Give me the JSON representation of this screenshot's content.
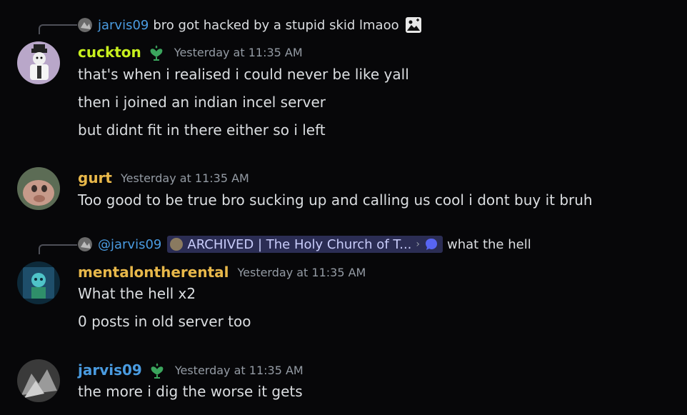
{
  "messages": [
    {
      "reply": {
        "author": "jarvis09",
        "text": "bro got hacked by a stupid skid lmaoo"
      },
      "author": "cuckton",
      "author_color": "#c8f01e",
      "timestamp": "Yesterday at 11:35 AM",
      "lines": [
        "that's when i realised i could never be like yall",
        "then i joined an indian incel server",
        "but didnt fit in there either so i left"
      ]
    },
    {
      "author": "gurt",
      "author_color": "#e8b84a",
      "timestamp": "Yesterday at 11:35 AM",
      "lines": [
        "Too good to be true bro sucking up and calling us cool i dont buy it bruh"
      ]
    },
    {
      "reply": {
        "author": "@jarvis09",
        "channel": "ARCHIVED | The Holy Church of T...",
        "text": "what the hell"
      },
      "author": "mentalontherental",
      "author_color": "#e8b84a",
      "timestamp": "Yesterday at 11:35 AM",
      "lines": [
        "What the hell x2",
        "0 posts in old server too"
      ]
    },
    {
      "author": "jarvis09",
      "author_color": "#4a9be0",
      "timestamp": "Yesterday at 11:35 AM",
      "lines": [
        "the more i dig the worse it gets"
      ]
    }
  ],
  "icons": {
    "badge": "heart-plant-icon",
    "image_attachment": "image-icon",
    "thread": "chat-bubble-icon",
    "chevron": "chevron-right-icon"
  },
  "colors": {
    "background": "#070709",
    "link_blue": "#4a9be0",
    "badge_green": "#3ba55d"
  }
}
